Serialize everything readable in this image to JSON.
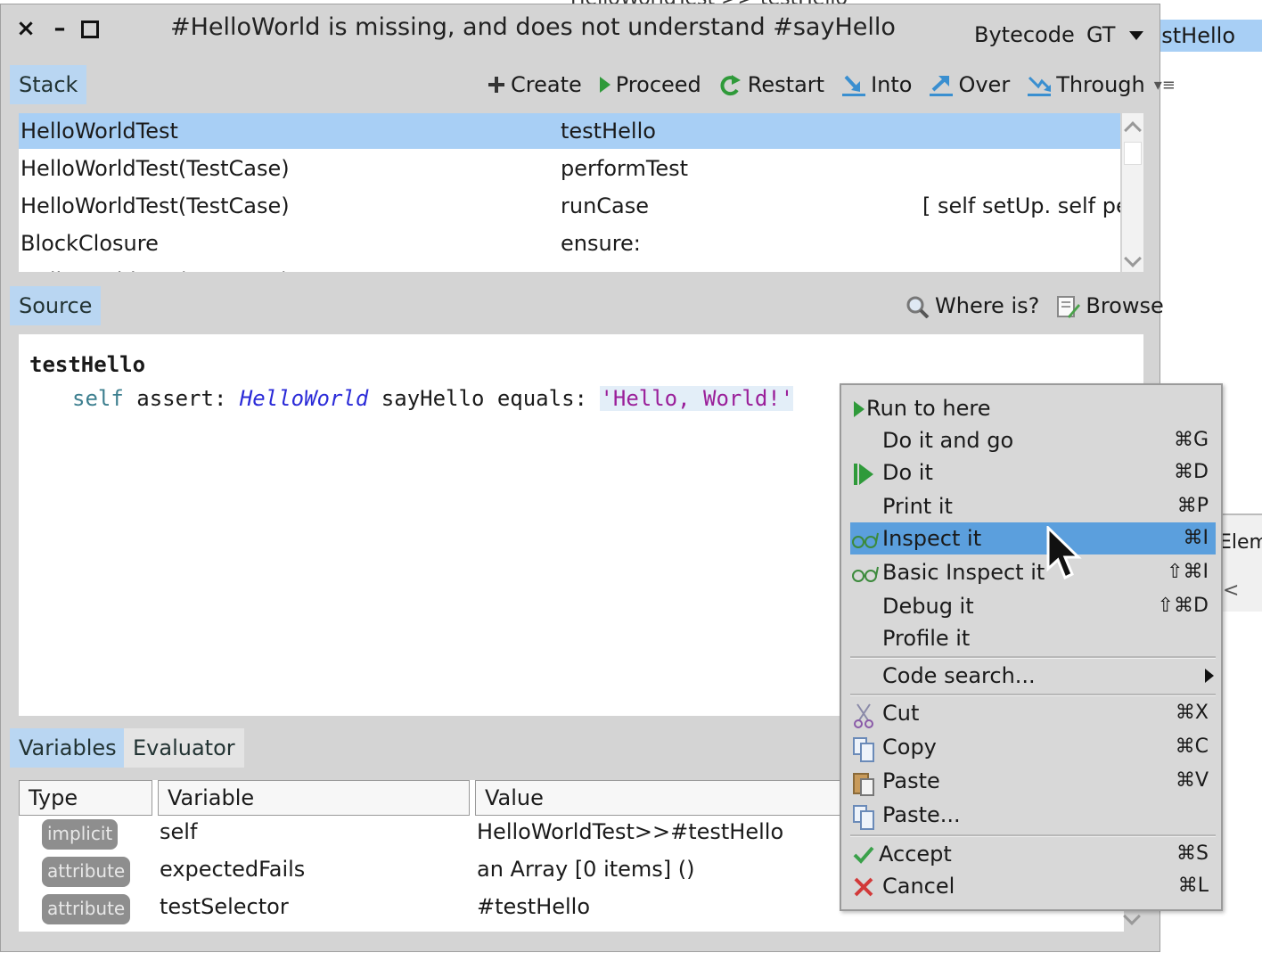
{
  "background": {
    "top_title_fragment": "HelloWorldTest >> testHello",
    "strip_text": "testHello",
    "fragment2_text": "Elemen",
    "fragment2_glyph": "<"
  },
  "window": {
    "title": "#HelloWorld is missing, and does not understand #sayHello",
    "bytecode_label": "Bytecode",
    "gt_label": "GT",
    "close_glyph": "×",
    "min_glyph": "–"
  },
  "stack": {
    "tab_label": "Stack",
    "toolbar": [
      {
        "label": "Create",
        "icon": "plus-icon"
      },
      {
        "label": "Proceed",
        "icon": "play-icon"
      },
      {
        "label": "Restart",
        "icon": "restart-icon"
      },
      {
        "label": "Into",
        "icon": "step-into-icon"
      },
      {
        "label": "Over",
        "icon": "step-over-icon"
      },
      {
        "label": "Through",
        "icon": "step-through-icon"
      }
    ],
    "menu_glyph": "▾≡",
    "rows": [
      {
        "receiver": "HelloWorldTest",
        "method": "testHello",
        "extra": ""
      },
      {
        "receiver": "HelloWorldTest(TestCase)",
        "method": "performTest",
        "extra": ""
      },
      {
        "receiver": "HelloWorldTest(TestCase)",
        "method": "runCase",
        "extra": "[ self setUp. self perfo"
      },
      {
        "receiver": "BlockClosure",
        "method": "ensure:",
        "extra": ""
      },
      {
        "receiver": "HelloWorldTest(TestCase)",
        "method": "runCase",
        "extra": ""
      }
    ]
  },
  "source": {
    "tab_label": "Source",
    "where_is_label": "Where is?",
    "browse_label": "Browse",
    "method_name": "testHello",
    "code_self": "self",
    "code_assert": " assert: ",
    "code_class": "HelloWorld",
    "code_send": " sayHello equals: ",
    "code_string": "'Hello, World!'"
  },
  "bottom": {
    "tab_variables": "Variables",
    "tab_evaluator": "Evaluator",
    "headers": [
      "Type",
      "Variable",
      "Value"
    ],
    "rows": [
      {
        "type": "implicit",
        "variable": "self",
        "value": "HelloWorldTest>>#testHello"
      },
      {
        "type": "attribute",
        "variable": "expectedFails",
        "value": "an Array [0 items] ()"
      },
      {
        "type": "attribute",
        "variable": "testSelector",
        "value": "#testHello"
      }
    ]
  },
  "context_menu": {
    "items": [
      {
        "label": "Run to here",
        "shortcut": "",
        "icon": "play-small-icon"
      },
      {
        "label": "Do it and go",
        "shortcut": "⌘G",
        "icon": ""
      },
      {
        "label": "Do it",
        "shortcut": "⌘D",
        "icon": "play-icon"
      },
      {
        "label": "Print it",
        "shortcut": "⌘P",
        "icon": ""
      },
      {
        "label": "Inspect it",
        "shortcut": "⌘I",
        "icon": "glasses-icon",
        "selected": true
      },
      {
        "label": "Basic Inspect it",
        "shortcut": "⇧⌘I",
        "icon": "glasses-icon"
      },
      {
        "label": "Debug it",
        "shortcut": "⇧⌘D",
        "icon": ""
      },
      {
        "label": "Profile it",
        "shortcut": "",
        "icon": ""
      },
      {
        "label": "Code search...",
        "shortcut": "",
        "icon": "",
        "submenu": true
      },
      {
        "label": "Cut",
        "shortcut": "⌘X",
        "icon": "scissors-icon"
      },
      {
        "label": "Copy",
        "shortcut": "⌘C",
        "icon": "copy-icon"
      },
      {
        "label": "Paste",
        "shortcut": "⌘V",
        "icon": "paste-icon"
      },
      {
        "label": "Paste...",
        "shortcut": "",
        "icon": "paste-icon"
      },
      {
        "label": "Accept",
        "shortcut": "⌘S",
        "icon": "check-icon"
      },
      {
        "label": "Cancel",
        "shortcut": "⌘L",
        "icon": "cross-icon"
      }
    ]
  },
  "colors": {
    "selection": "#a8cff5",
    "menu_selection": "#5b9fdd",
    "panel_bg": "#d4d4d4",
    "green_icon": "#2f9a3a"
  }
}
